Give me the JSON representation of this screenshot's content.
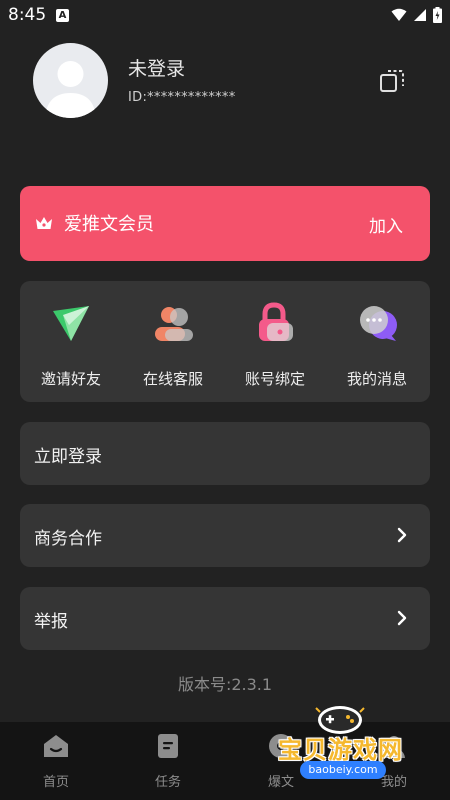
{
  "status_bar": {
    "time": "8:45",
    "notification_badge": "A"
  },
  "profile": {
    "username": "未登录",
    "user_id": "ID:*************"
  },
  "vip": {
    "title": "爱推文会员",
    "join_label": "加入",
    "color": "#f4526b"
  },
  "quick_actions": [
    {
      "label": "邀请好友",
      "icon": "invite-icon"
    },
    {
      "label": "在线客服",
      "icon": "customer-service-icon"
    },
    {
      "label": "账号绑定",
      "icon": "lock-icon"
    },
    {
      "label": "我的消息",
      "icon": "message-bubble-icon"
    }
  ],
  "menu": [
    {
      "label": "立即登录",
      "has_chevron": false
    },
    {
      "label": "商务合作",
      "has_chevron": true
    },
    {
      "label": "举报",
      "has_chevron": true
    }
  ],
  "version": "版本号:2.3.1",
  "bottom_nav": [
    {
      "label": "首页",
      "icon": "home-icon"
    },
    {
      "label": "任务",
      "icon": "task-icon"
    },
    {
      "label": "爆文",
      "icon": "hot-article-icon"
    },
    {
      "label": "我的",
      "icon": "profile-icon"
    }
  ],
  "watermark": {
    "title": "宝贝游戏网",
    "url": "baobeiy.com"
  }
}
